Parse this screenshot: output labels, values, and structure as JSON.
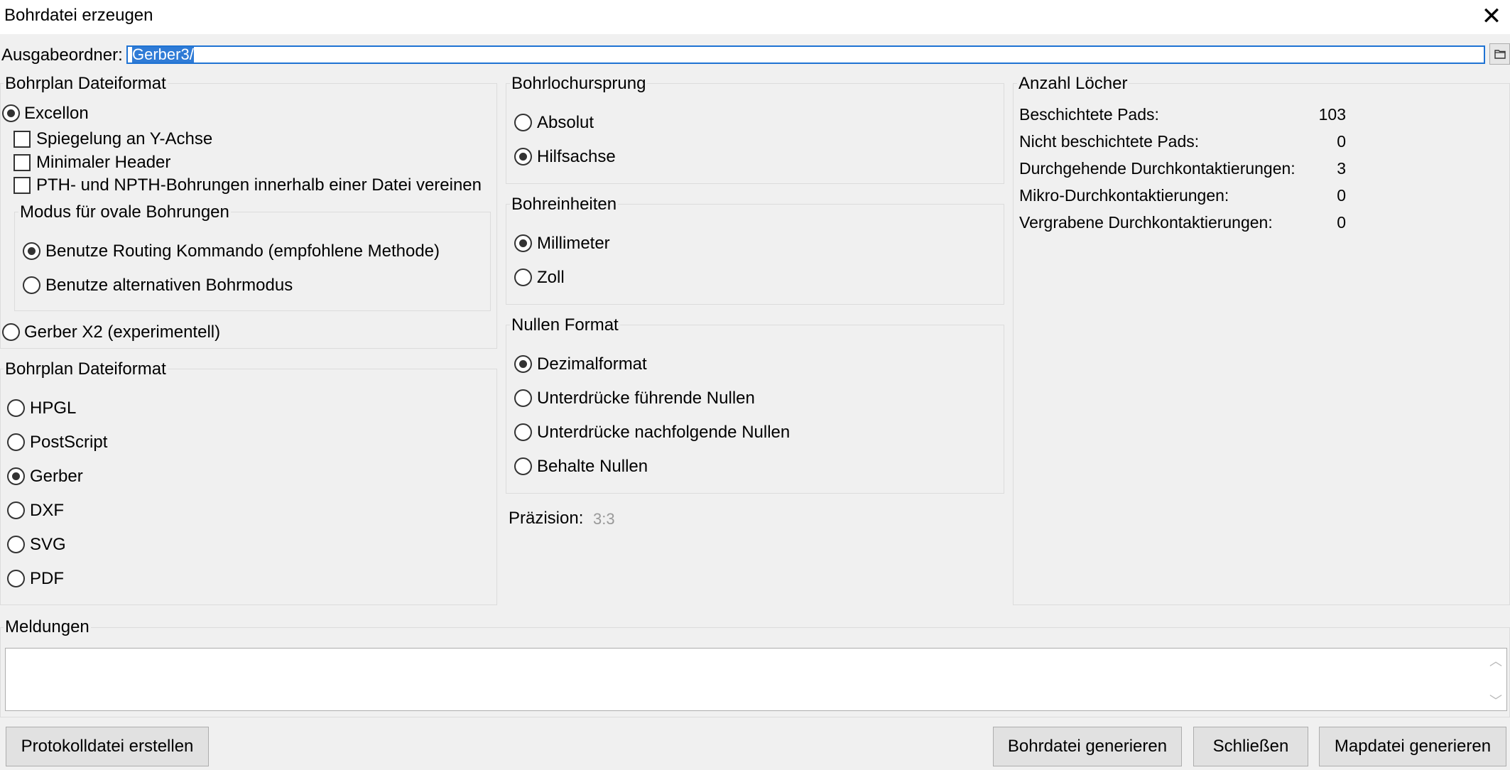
{
  "window": {
    "title": "Bohrdatei erzeugen",
    "close_glyph": "✕"
  },
  "output": {
    "label": "Ausgabeordner:",
    "value": "Gerber3/",
    "browse_icon": "folder-icon"
  },
  "drill_format": {
    "title": "Bohrplan Dateiformat",
    "excellon": "Excellon",
    "mirror_y": "Spiegelung an Y-Achse",
    "minimal_header": "Minimaler Header",
    "merge_pth": "PTH- und NPTH-Bohrungen innerhalb einer Datei vereinen",
    "oval_mode": {
      "title": "Modus für ovale Bohrungen",
      "routing": "Benutze Routing Kommando (empfohlene Methode)",
      "alternative": "Benutze alternativen Bohrmodus"
    },
    "gerber_x2": "Gerber X2 (experimentell)"
  },
  "map_format": {
    "title": "Bohrplan Dateiformat",
    "options": [
      "HPGL",
      "PostScript",
      "Gerber",
      "DXF",
      "SVG",
      "PDF"
    ],
    "selected": "Gerber"
  },
  "origin": {
    "title": "Bohrlochursprung",
    "absolute": "Absolut",
    "aux_axis": "Hilfsachse"
  },
  "units": {
    "title": "Bohreinheiten",
    "mm": "Millimeter",
    "inch": "Zoll"
  },
  "zeros": {
    "title": "Nullen Format",
    "decimal": "Dezimalformat",
    "suppress_leading": "Unterdrücke führende Nullen",
    "suppress_trailing": "Unterdrücke nachfolgende Nullen",
    "keep": "Behalte Nullen"
  },
  "precision": {
    "label": "Präzision:",
    "value": "3:3"
  },
  "holes": {
    "title": "Anzahl Löcher",
    "rows": [
      {
        "label": "Beschichtete Pads:",
        "value": "103"
      },
      {
        "label": "Nicht beschichtete Pads:",
        "value": "0"
      },
      {
        "label": "Durchgehende Durchkontaktierungen:",
        "value": "3"
      },
      {
        "label": "Mikro-Durchkontaktierungen:",
        "value": "0"
      },
      {
        "label": "Vergrabene Durchkontaktierungen:",
        "value": "0"
      }
    ]
  },
  "messages": {
    "title": "Meldungen"
  },
  "buttons": {
    "report": "Protokolldatei erstellen",
    "generate_drill": "Bohrdatei generieren",
    "close": "Schließen",
    "generate_map": "Mapdatei generieren"
  },
  "scroll": {
    "up": "︿",
    "down": "﹀"
  }
}
